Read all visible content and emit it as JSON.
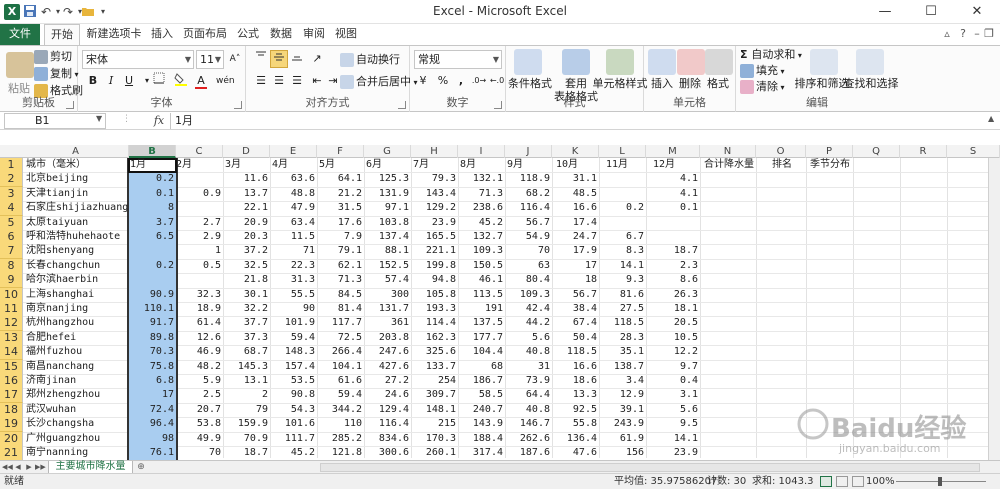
{
  "window": {
    "title": "Excel - Microsoft Excel",
    "minimize": "—",
    "maximize": "☐",
    "close": "✕"
  },
  "quick_access": {
    "undo": "↶",
    "redo": "↷",
    "dropdown": "▾"
  },
  "tabs": [
    "文件",
    "开始",
    "新建选项卡",
    "插入",
    "页面布局",
    "公式",
    "数据",
    "审阅",
    "视图"
  ],
  "ribbon": {
    "clipboard": {
      "paste": "粘贴",
      "cut": "剪切",
      "copy": "复制",
      "format_painter": "格式刷",
      "label": "剪贴板"
    },
    "font": {
      "name": "宋体",
      "size": "11",
      "bold": "B",
      "italic": "I",
      "underline": "U",
      "label": "字体"
    },
    "alignment": {
      "wrap": "自动换行",
      "merge": "合并后居中",
      "label": "对齐方式"
    },
    "number": {
      "format": "常规",
      "percent": "%",
      "comma": ",",
      "label": "数字"
    },
    "styles": {
      "conditional": "条件格式",
      "table_1": "套用",
      "table_2": "表格格式",
      "cell_styles": "单元格样式",
      "label": "样式"
    },
    "cells": {
      "insert": "插入",
      "delete": "删除",
      "format": "格式",
      "label": "单元格"
    },
    "editing": {
      "autosum": "自动求和",
      "fill": "填充",
      "clear": "清除",
      "sort": "排序和筛选",
      "find": "查找和选择",
      "label": "编辑"
    }
  },
  "formula_bar": {
    "name_box": "B1",
    "fx": "fx",
    "content": "1月"
  },
  "columns": [
    "A",
    "B",
    "C",
    "D",
    "E",
    "F",
    "G",
    "H",
    "I",
    "J",
    "K",
    "L",
    "M",
    "N",
    "O",
    "P",
    "Q",
    "R",
    "S"
  ],
  "header_row": [
    "城市（毫米）",
    "1月",
    "2月",
    "3月",
    "4月",
    "5月",
    "6月",
    "7月",
    "8月",
    "9月",
    "10月",
    "11月",
    "12月",
    "合计降水量",
    "排名",
    "季节分布"
  ],
  "rows": [
    {
      "n": "2",
      "city": "北京beijing",
      "v": [
        "0.2",
        "",
        "11.6",
        "63.6",
        "64.1",
        "125.3",
        "79.3",
        "132.1",
        "118.9",
        "31.1",
        "",
        "4.1"
      ]
    },
    {
      "n": "3",
      "city": "天津tianjin",
      "v": [
        "0.1",
        "0.9",
        "13.7",
        "48.8",
        "21.2",
        "131.9",
        "143.4",
        "71.3",
        "68.2",
        "48.5",
        "",
        "4.1"
      ]
    },
    {
      "n": "4",
      "city": "石家庄shijiazhuang",
      "v": [
        "8",
        "",
        "22.1",
        "47.9",
        "31.5",
        "97.1",
        "129.2",
        "238.6",
        "116.4",
        "16.6",
        "0.2",
        "0.1"
      ]
    },
    {
      "n": "5",
      "city": "太原taiyuan",
      "v": [
        "3.7",
        "2.7",
        "20.9",
        "63.4",
        "17.6",
        "103.8",
        "23.9",
        "45.2",
        "56.7",
        "17.4",
        "",
        ""
      ]
    },
    {
      "n": "6",
      "city": "呼和浩特huhehaote",
      "v": [
        "6.5",
        "2.9",
        "20.3",
        "11.5",
        "7.9",
        "137.4",
        "165.5",
        "132.7",
        "54.9",
        "24.7",
        "6.7",
        ""
      ]
    },
    {
      "n": "7",
      "city": "沈阳shenyang",
      "v": [
        "",
        "1",
        "37.2",
        "71",
        "79.1",
        "88.1",
        "221.1",
        "109.3",
        "70",
        "17.9",
        "8.3",
        "18.7"
      ]
    },
    {
      "n": "8",
      "city": "长春changchun",
      "v": [
        "0.2",
        "0.5",
        "32.5",
        "22.3",
        "62.1",
        "152.5",
        "199.8",
        "150.5",
        "63",
        "17",
        "14.1",
        "2.3"
      ]
    },
    {
      "n": "9",
      "city": "哈尔滨haerbin",
      "v": [
        "",
        "",
        "21.8",
        "31.3",
        "71.3",
        "57.4",
        "94.8",
        "46.1",
        "80.4",
        "18",
        "9.3",
        "8.6"
      ]
    },
    {
      "n": "10",
      "city": "上海shanghai",
      "v": [
        "90.9",
        "32.3",
        "30.1",
        "55.5",
        "84.5",
        "300",
        "105.8",
        "113.5",
        "109.3",
        "56.7",
        "81.6",
        "26.3"
      ]
    },
    {
      "n": "11",
      "city": "南京nanjing",
      "v": [
        "110.1",
        "18.9",
        "32.2",
        "90",
        "81.4",
        "131.7",
        "193.3",
        "191",
        "42.4",
        "38.4",
        "27.5",
        "18.1"
      ]
    },
    {
      "n": "12",
      "city": "杭州hangzhou",
      "v": [
        "91.7",
        "61.4",
        "37.7",
        "101.9",
        "117.7",
        "361",
        "114.4",
        "137.5",
        "44.2",
        "67.4",
        "118.5",
        "20.5"
      ]
    },
    {
      "n": "13",
      "city": "合肥hefei",
      "v": [
        "89.8",
        "12.6",
        "37.3",
        "59.4",
        "72.5",
        "203.8",
        "162.3",
        "177.7",
        "5.6",
        "50.4",
        "28.3",
        "10.5"
      ]
    },
    {
      "n": "14",
      "city": "福州fuzhou",
      "v": [
        "70.3",
        "46.9",
        "68.7",
        "148.3",
        "266.4",
        "247.6",
        "325.6",
        "104.4",
        "40.8",
        "118.5",
        "35.1",
        "12.2"
      ]
    },
    {
      "n": "15",
      "city": "南昌nanchang",
      "v": [
        "75.8",
        "48.2",
        "145.3",
        "157.4",
        "104.1",
        "427.6",
        "133.7",
        "68",
        "31",
        "16.6",
        "138.7",
        "9.7"
      ]
    },
    {
      "n": "16",
      "city": "济南jinan",
      "v": [
        "6.8",
        "5.9",
        "13.1",
        "53.5",
        "61.6",
        "27.2",
        "254",
        "186.7",
        "73.9",
        "18.6",
        "3.4",
        "0.4"
      ]
    },
    {
      "n": "17",
      "city": "郑州zhengzhou",
      "v": [
        "17",
        "2.5",
        "2",
        "90.8",
        "59.4",
        "24.6",
        "309.7",
        "58.5",
        "64.4",
        "13.3",
        "12.9",
        "3.1"
      ]
    },
    {
      "n": "18",
      "city": "武汉wuhan",
      "v": [
        "72.4",
        "20.7",
        "79",
        "54.3",
        "344.2",
        "129.4",
        "148.1",
        "240.7",
        "40.8",
        "92.5",
        "39.1",
        "5.6"
      ]
    },
    {
      "n": "19",
      "city": "长沙changsha",
      "v": [
        "96.4",
        "53.8",
        "159.9",
        "101.6",
        "110",
        "116.4",
        "215",
        "143.9",
        "146.7",
        "55.8",
        "243.9",
        "9.5"
      ]
    },
    {
      "n": "20",
      "city": "广州guangzhou",
      "v": [
        "98",
        "49.9",
        "70.9",
        "111.7",
        "285.2",
        "834.6",
        "170.3",
        "188.4",
        "262.6",
        "136.4",
        "61.9",
        "14.1"
      ]
    },
    {
      "n": "21",
      "city": "南宁nanning",
      "v": [
        "76.1",
        "70",
        "18.7",
        "45.2",
        "121.8",
        "300.6",
        "260.1",
        "317.4",
        "187.6",
        "47.6",
        "156",
        "23.9"
      ]
    }
  ],
  "sheet_nav": {
    "first": "◀◀",
    "prev": "◀",
    "next": "▶",
    "last": "▶▶",
    "new_sheet": "⊕"
  },
  "sheet_tab": "主要城市降水量",
  "status": {
    "ready": "就绪",
    "average": "平均值: 35.97586207",
    "count": "计数: 30",
    "sum": "求和: 1043.3",
    "zoom": "100%"
  },
  "watermark": {
    "brand": "Baidu经验",
    "url": "jingyan.baidu.com"
  },
  "colors": {
    "excel_green": "#217346",
    "row_header_yellow": "#f9d97a",
    "selection_blue": "#a9cdf0"
  }
}
